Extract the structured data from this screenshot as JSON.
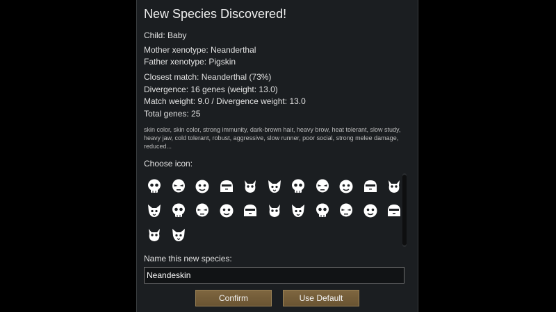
{
  "dialog": {
    "title": "New Species Discovered!",
    "child": "Child: Baby",
    "mother": "Mother xenotype: Neanderthal",
    "father": "Father xenotype: Pigskin",
    "closest_match": "Closest match: Neanderthal (73%)",
    "divergence": "Divergence: 16 genes (weight: 13.0)",
    "weights": "Match weight: 9.0 / Divergence weight: 13.0",
    "total_genes": "Total genes: 25",
    "genes_list": "skin color, skin color, strong immunity, dark-brown hair, heavy brow, heat tolerant, slow study, heavy jaw, cold tolerant, robust, aggressive, slow runner, poor social, strong melee damage, reduced...",
    "choose_icon_label": "Choose icon:",
    "name_label": "Name this new species:",
    "name_value": "Neandeskin",
    "confirm_label": "Confirm",
    "default_label": "Use Default"
  },
  "icons": [
    "skull-icon",
    "skull-scowl-icon",
    "skull-grin-icon",
    "skull-teeth-icon",
    "skull-plain-icon",
    "skull-eyes-icon",
    "head-round-icon",
    "head-visor-icon",
    "head-band-icon",
    "head-frown-icon",
    "head-partial-icon",
    "head-bearded-icon",
    "head-goggles-icon",
    "head-hooded-icon",
    "head-helmet-icon",
    "head-tusked-icon",
    "head-eared-icon",
    "head-box-icon",
    "head-horned-icon",
    "head-curled-icon",
    "head-stripe-icon",
    "head-ghost-icon",
    "head-devil-icon",
    "head-fox-icon"
  ],
  "colors": {
    "panel": "#1b1e21",
    "button": "#75603b",
    "icon": "#ffffff"
  }
}
